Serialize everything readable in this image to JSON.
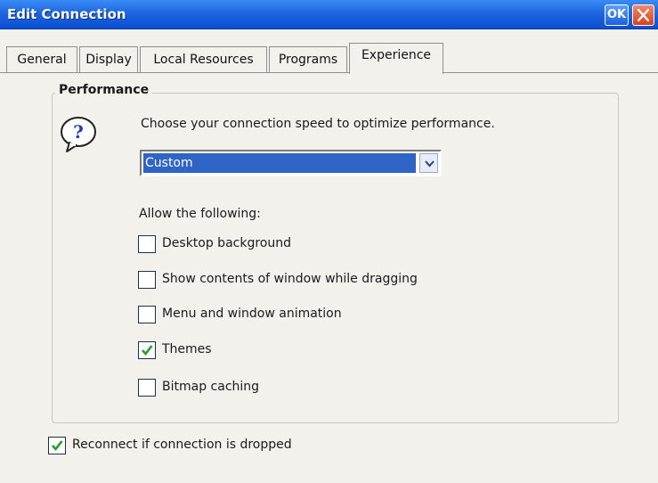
{
  "window": {
    "title": "Edit Connection",
    "ok_label": "OK"
  },
  "tabs": [
    {
      "label": "General",
      "active": false
    },
    {
      "label": "Display",
      "active": false
    },
    {
      "label": "Local Resources",
      "active": false
    },
    {
      "label": "Programs",
      "active": false
    },
    {
      "label": "Experience",
      "active": true
    }
  ],
  "performance": {
    "group_title": "Performance",
    "icon": "question-icon",
    "prompt": "Choose your connection speed to optimize performance.",
    "speed_select": {
      "selected": "Custom"
    },
    "allow_label": "Allow the following:",
    "options": [
      {
        "label": "Desktop background",
        "checked": false
      },
      {
        "label": "Show contents of window while dragging",
        "checked": false
      },
      {
        "label": "Menu and window animation",
        "checked": false
      },
      {
        "label": "Themes",
        "checked": true
      },
      {
        "label": "Bitmap caching",
        "checked": false
      }
    ]
  },
  "reconnect": {
    "label": "Reconnect if connection is dropped",
    "checked": true
  },
  "colors": {
    "title_bar": "#1f66e0",
    "selection": "#2f63c5",
    "checkmark": "#21a121",
    "close_button": "#d8421e"
  }
}
